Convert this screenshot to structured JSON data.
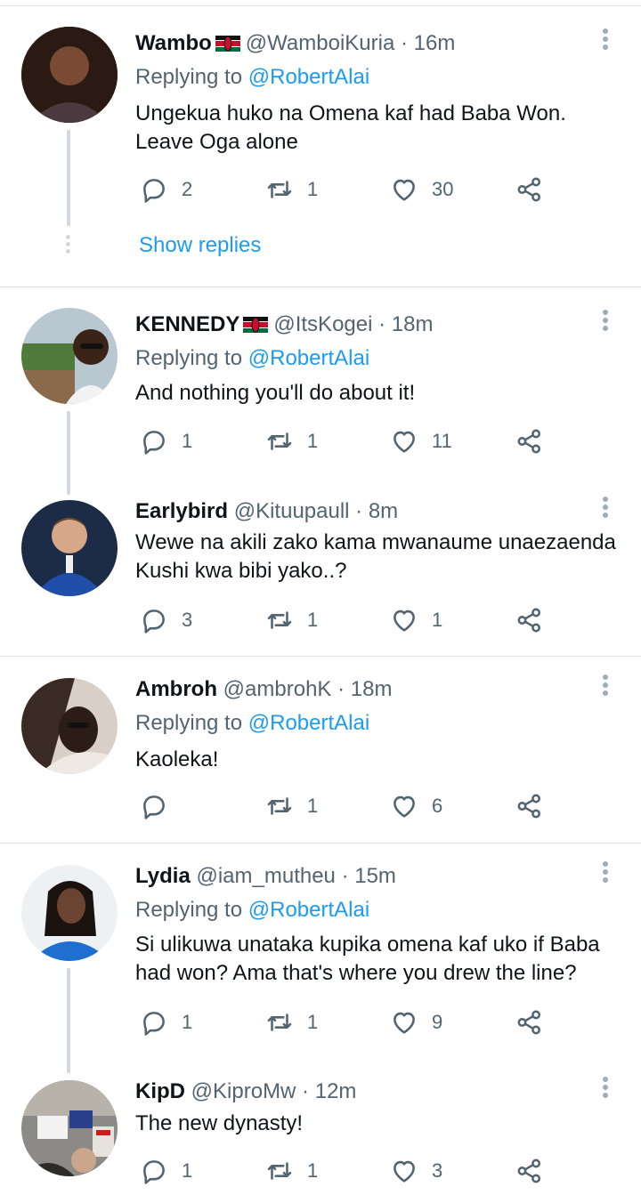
{
  "replying_label": "Replying to",
  "tweets": [
    {
      "name": "Wambo",
      "has_flag": true,
      "handle": "@WamboiKuria",
      "time": "16m",
      "replying_to": "@RobertAlai",
      "text": "Ungekua huko na Omena kaf had Baba Won. Leave Oga alone",
      "replies": "2",
      "retweets": "1",
      "likes": "30"
    },
    {
      "name": "KENNEDY",
      "has_flag": true,
      "handle": "@ItsKogei",
      "time": "18m",
      "replying_to": "@RobertAlai",
      "text": "And nothing you'll do about it!",
      "replies": "1",
      "retweets": "1",
      "likes": "11"
    },
    {
      "name": "Earlybird",
      "has_flag": false,
      "handle": "@Kituupaull",
      "time": "8m",
      "replying_to": "",
      "text": "Wewe na akili zako kama mwanaume unaezaenda Kushi kwa bibi yako..?",
      "replies": "3",
      "retweets": "1",
      "likes": "1"
    },
    {
      "name": "Ambroh",
      "has_flag": false,
      "handle": "@ambrohK",
      "time": "18m",
      "replying_to": "@RobertAlai",
      "text": "Kaoleka!",
      "replies": "",
      "retweets": "1",
      "likes": "6"
    },
    {
      "name": "Lydia",
      "has_flag": false,
      "handle": "@iam_mutheu",
      "time": "15m",
      "replying_to": "@RobertAlai",
      "text": "Si ulikuwa unataka kupika omena kaf uko if Baba had won? Ama that's where you drew the line?",
      "replies": "1",
      "retweets": "1",
      "likes": "9"
    },
    {
      "name": "KipD",
      "has_flag": false,
      "handle": "@KiproMw",
      "time": "12m",
      "replying_to": "",
      "text": "The new dynasty!",
      "replies": "1",
      "retweets": "1",
      "likes": "3"
    }
  ],
  "show_replies": "Show replies",
  "colors": {
    "accent": "#1d9bf0",
    "muted": "#536471",
    "divider": "#dfe3e6"
  }
}
